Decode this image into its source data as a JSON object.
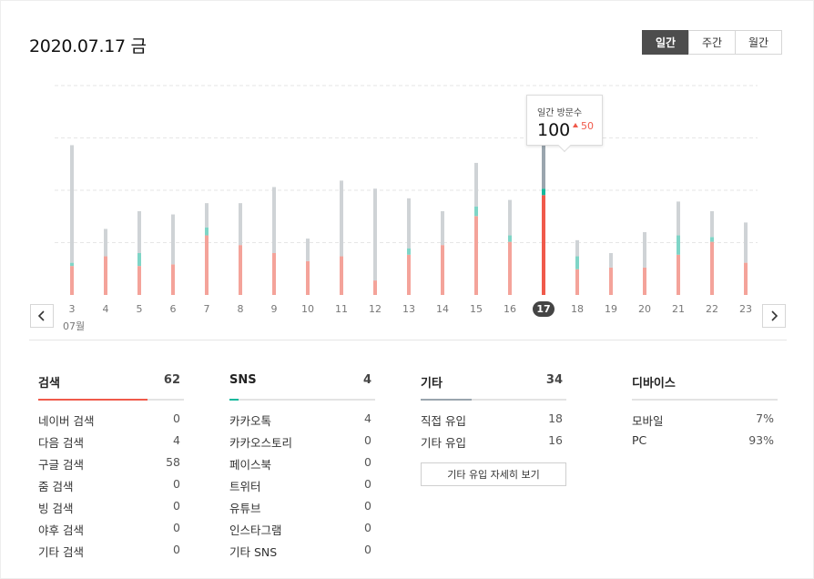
{
  "header": {
    "date_title": "2020.07.17 금",
    "period_tabs": [
      {
        "label": "일간",
        "active": true
      },
      {
        "label": "주간",
        "active": false
      },
      {
        "label": "월간",
        "active": false
      }
    ]
  },
  "tooltip": {
    "label": "일간 방문수",
    "value": "100",
    "delta": "50"
  },
  "colors": {
    "search": "#f4a39a",
    "sns": "#7fd5c7",
    "other": "#cfd3d6",
    "selected_search": "#f05a4b",
    "selected_sns": "#14b89c",
    "selected_other": "#9aa5ae",
    "selected_badge": "#444444"
  },
  "chart_data": {
    "type": "bar",
    "stacked": true,
    "x": [
      "3",
      "4",
      "5",
      "6",
      "7",
      "8",
      "9",
      "10",
      "11",
      "12",
      "13",
      "14",
      "15",
      "16",
      "17",
      "18",
      "19",
      "20",
      "21",
      "22",
      "23"
    ],
    "x_sublabel": "07월",
    "selected": "17",
    "ylim": [
      0,
      130
    ],
    "gridlines": 4,
    "series": [
      {
        "name": "검색",
        "values": [
          18,
          24,
          18,
          19,
          37,
          31,
          26,
          21,
          24,
          9,
          25,
          31,
          49,
          33,
          62,
          16,
          17,
          17,
          25,
          33,
          20
        ]
      },
      {
        "name": "SNS",
        "values": [
          2,
          0,
          8,
          0,
          5,
          0,
          0,
          0,
          0,
          0,
          4,
          0,
          6,
          4,
          4,
          8,
          0,
          0,
          12,
          3,
          0
        ]
      },
      {
        "name": "기타",
        "values": [
          73,
          17,
          26,
          31,
          15,
          26,
          41,
          14,
          47,
          57,
          31,
          21,
          27,
          22,
          34,
          10,
          9,
          22,
          21,
          16,
          25
        ]
      }
    ]
  },
  "nav": {
    "prev_icon": "chevron-left-icon",
    "next_icon": "chevron-right-icon"
  },
  "panels": {
    "search": {
      "title": "검색",
      "total": "62",
      "ratio": 0.75,
      "rows": [
        {
          "label": "네이버 검색",
          "value": "0"
        },
        {
          "label": "다음 검색",
          "value": "4"
        },
        {
          "label": "구글 검색",
          "value": "58"
        },
        {
          "label": "줌 검색",
          "value": "0"
        },
        {
          "label": "빙 검색",
          "value": "0"
        },
        {
          "label": "야후 검색",
          "value": "0"
        },
        {
          "label": "기타 검색",
          "value": "0"
        }
      ]
    },
    "sns": {
      "title": "SNS",
      "total": "4",
      "ratio": 0.06,
      "rows": [
        {
          "label": "카카오톡",
          "value": "4"
        },
        {
          "label": "카카오스토리",
          "value": "0"
        },
        {
          "label": "페이스북",
          "value": "0"
        },
        {
          "label": "트위터",
          "value": "0"
        },
        {
          "label": "유튜브",
          "value": "0"
        },
        {
          "label": "인스타그램",
          "value": "0"
        },
        {
          "label": "기타 SNS",
          "value": "0"
        }
      ]
    },
    "etc": {
      "title": "기타",
      "total": "34",
      "ratio": 0.35,
      "rows": [
        {
          "label": "직접 유입",
          "value": "18"
        },
        {
          "label": "기타 유입",
          "value": "16"
        }
      ],
      "detail_button": "기타 유입 자세히 보기"
    },
    "device": {
      "title": "디바이스",
      "rows": [
        {
          "label": "모바일",
          "value": "7%"
        },
        {
          "label": "PC",
          "value": "93%"
        }
      ]
    }
  }
}
